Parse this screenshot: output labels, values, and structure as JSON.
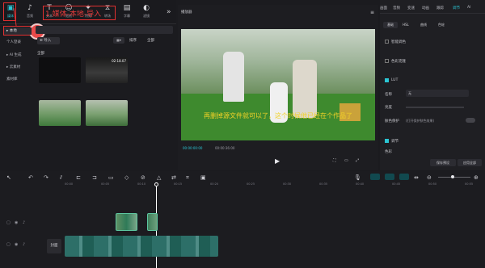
{
  "toolbar": {
    "items": [
      {
        "label": "媒体",
        "icon": "media-icon"
      },
      {
        "label": "音频",
        "icon": "audio-icon"
      },
      {
        "label": "文本",
        "icon": "text-icon"
      },
      {
        "label": "贴纸",
        "icon": "sticker-icon"
      },
      {
        "label": "特效",
        "icon": "effects-icon"
      },
      {
        "label": "转场",
        "icon": "transition-icon"
      },
      {
        "label": "字幕",
        "icon": "caption-icon"
      },
      {
        "label": "滤镜",
        "icon": "filter-icon"
      }
    ],
    "annotation": "1 媒体-本地-导入",
    "annotation_marker": "!"
  },
  "sidebar": {
    "items": [
      "▸ 本地",
      "个人登录",
      "▸ AI 生成",
      "▸ 云素材",
      "素材库"
    ]
  },
  "media": {
    "import_label": "导入",
    "all_label": "全部",
    "sort_label": "排序",
    "filter_label": "全部",
    "durations": [
      "",
      "02:18.07",
      "",
      ""
    ]
  },
  "player": {
    "title": "播放器",
    "subtitle": "再删掉源文件就可以了，这个时候他已经在个作品了",
    "time_current": "00:00:00:00",
    "time_total": "00:00:36:00"
  },
  "properties": {
    "tabs": [
      "画面",
      "音频",
      "变速",
      "动画",
      "跟踪",
      "调节",
      "AI"
    ],
    "subtabs": [
      "基础",
      "HSL",
      "曲线",
      "色轮"
    ],
    "rows": [
      "智能调色",
      "色彩克隆",
      "LUT",
      "名称",
      "亮度",
      "肤色保护",
      "调节",
      "色彩"
    ],
    "lut_value": "无",
    "skin_text": "(打开保护肤色效果)",
    "save_preset": "保存预设",
    "apply_all": "应用全部"
  },
  "timeline": {
    "ruler": [
      "00:00",
      "00:05",
      "00:10",
      "00:15",
      "00:20",
      "00:25",
      "00:30",
      "00:35",
      "00:40",
      "00:45",
      "00:50",
      "00:55"
    ],
    "cover_label": "封面"
  },
  "colors": {
    "accent": "#2bc6d4",
    "annotation": "#e03030"
  }
}
